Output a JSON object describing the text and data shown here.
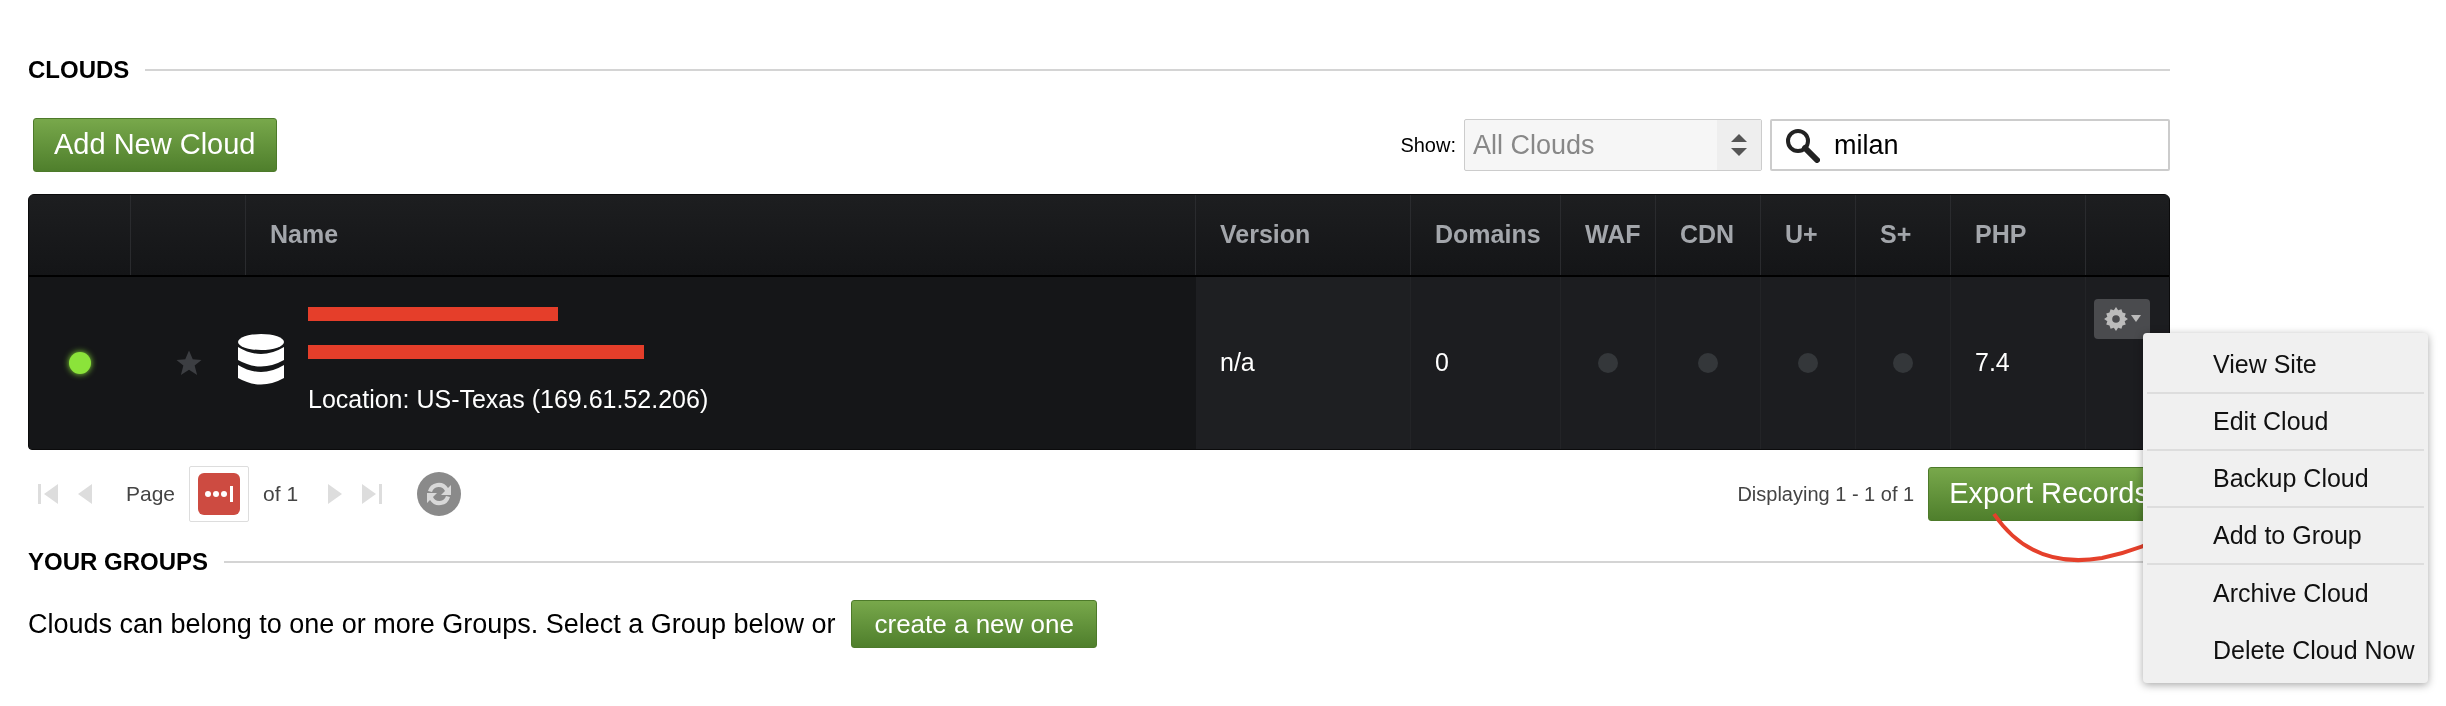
{
  "section_title": "CLOUDS",
  "add_button": "Add New Cloud",
  "filter": {
    "label": "Show:",
    "value": "All Clouds"
  },
  "search": {
    "value": "milan"
  },
  "table": {
    "columns": [
      "Name",
      "Version",
      "Domains",
      "WAF",
      "CDN",
      "U+",
      "S+",
      "PHP"
    ],
    "rows": [
      {
        "online": true,
        "starred": false,
        "name_redacted": true,
        "url_redacted": true,
        "location": "Location: US-Texas (169.61.52.206)",
        "version": "n/a",
        "domains": "0",
        "waf": false,
        "cdn": false,
        "u_plus": false,
        "s_plus": false,
        "php": "7.4"
      }
    ]
  },
  "pager": {
    "page_label": "Page",
    "of": "of 1",
    "displaying": "Displaying 1 - 1 of 1",
    "export": "Export Records"
  },
  "menu": {
    "items": [
      {
        "label": "View Site",
        "divider": true
      },
      {
        "label": "Edit Cloud",
        "divider": true
      },
      {
        "label": "Backup Cloud",
        "divider": true
      },
      {
        "label": "Add to Group",
        "divider": true
      },
      {
        "label": "Archive Cloud",
        "divider": false
      },
      {
        "label": "Delete Cloud Now",
        "divider": false
      }
    ]
  },
  "groups": {
    "title": "YOUR GROUPS",
    "text": "Clouds can belong to one or more Groups. Select a Group below or",
    "button": "create a new one"
  }
}
